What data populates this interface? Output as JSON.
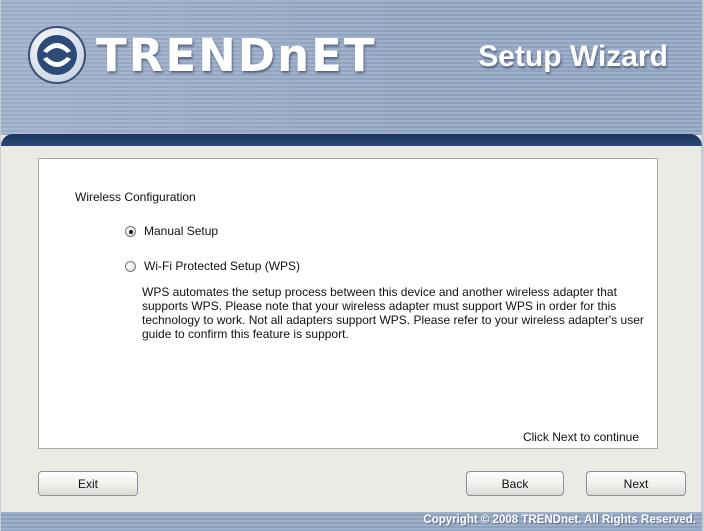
{
  "header": {
    "brand": "TRENDnET",
    "title": "Setup Wizard",
    "icon": "trendnet-logo-icon"
  },
  "content": {
    "section_title": "Wireless Configuration",
    "options": [
      {
        "label": "Manual Setup",
        "selected": true
      },
      {
        "label": "Wi-Fi Protected Setup (WPS)",
        "selected": false
      }
    ],
    "description": "WPS automates the setup process between this device and another wireless adapter that supports WPS. Please note that your wireless adapter must support WPS in order for this technology to work. Not all adapters support WPS. Please refer to your wireless adapter's user guide to confirm this feature is support.",
    "hint": "Click Next to continue"
  },
  "buttons": {
    "exit": "Exit",
    "back": "Back",
    "next": "Next"
  },
  "footer": {
    "copyright": "Copyright © 2008 TRENDnet. All Rights Reserved."
  },
  "colors": {
    "header_stripe": "#9fb0c9",
    "divider": "#1c3560",
    "window_bg": "#eceae4"
  }
}
